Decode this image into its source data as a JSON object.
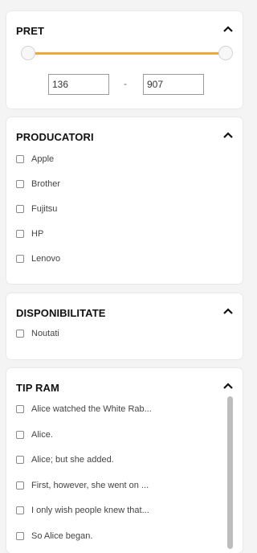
{
  "price": {
    "title": "PRET",
    "min_value": "136",
    "max_value": "907",
    "separator": "-",
    "slider_color": "#f0a63a"
  },
  "producers": {
    "title": "PRODUCATORI",
    "items": [
      {
        "label": "Apple"
      },
      {
        "label": "Brother"
      },
      {
        "label": "Fujitsu"
      },
      {
        "label": "HP"
      },
      {
        "label": "Lenovo"
      }
    ]
  },
  "availability": {
    "title": "DISPONIBILITATE",
    "items": [
      {
        "label": "Noutati"
      }
    ]
  },
  "ram_type": {
    "title": "TIP RAM",
    "items": [
      {
        "label": "Alice watched the White Rab..."
      },
      {
        "label": "Alice."
      },
      {
        "label": "Alice; but she added."
      },
      {
        "label": "First, however, she went on ..."
      },
      {
        "label": "I only wish people knew that..."
      },
      {
        "label": "So Alice began."
      }
    ]
  },
  "icons": {
    "collapse": "chevron-up-icon",
    "checkbox": "checkbox-icon"
  }
}
